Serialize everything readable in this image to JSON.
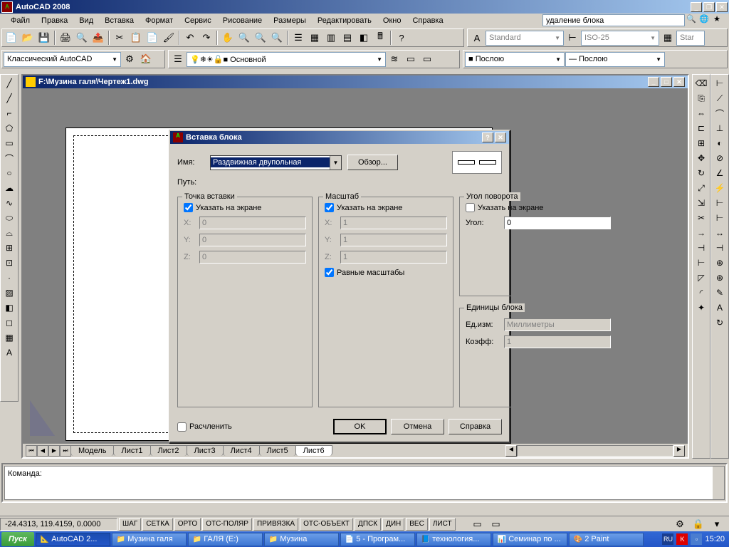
{
  "app": {
    "title": "AutoCAD 2008",
    "search_value": "удаление блока"
  },
  "menu": [
    "Файл",
    "Правка",
    "Вид",
    "Вставка",
    "Формат",
    "Сервис",
    "Рисование",
    "Размеры",
    "Редактировать",
    "Окно",
    "Справка"
  ],
  "toolbar3": {
    "workspace": "Классический AutoCAD",
    "layer": "Основной",
    "color": "Послою",
    "linetype": "Послою",
    "textstyle": "Standard",
    "dimstyle": "ISO-25",
    "tablestyle": "Star"
  },
  "doc": {
    "title": "F:\\Музина галя\\Чертеж1.dwg"
  },
  "tabs": [
    "Модель",
    "Лист1",
    "Лист2",
    "Лист3",
    "Лист4",
    "Лист5",
    "Лист6"
  ],
  "active_tab": "Лист6",
  "cmd": {
    "prompt": "Команда:"
  },
  "status": {
    "coords": "-24.4313, 119.4159, 0.0000",
    "buttons": [
      "ШАГ",
      "СЕТКА",
      "ОРТО",
      "ОТС-ПОЛЯР",
      "ПРИВЯЗКА",
      "ОТС-ОБЪЕКТ",
      "ДПСК",
      "ДИН",
      "ВЕС",
      "ЛИСТ"
    ]
  },
  "taskbar": {
    "start": "Пуск",
    "items": [
      "AutoCAD 2...",
      "Музина галя",
      "ГАЛЯ (E:)",
      "Музина",
      "5 - Програм...",
      "технология...",
      "Семинар по ...",
      "2 Paint"
    ],
    "active": 0,
    "lang": "RU",
    "time": "15:20"
  },
  "dialog": {
    "title": "Вставка блока",
    "name_label": "Имя:",
    "name_value": "Раздвижная двупольная",
    "browse": "Обзор...",
    "path_label": "Путь:",
    "group1": {
      "title": "Точка вставки",
      "specify": "Указать на экране",
      "x": "0",
      "y": "0",
      "z": "0"
    },
    "group2": {
      "title": "Масштаб",
      "specify": "Указать на экране",
      "x": "1",
      "y": "1",
      "z": "1",
      "uniform": "Равные масштабы"
    },
    "group3": {
      "title": "Угол поворота",
      "specify": "Указать на экране",
      "angle_label": "Угол:",
      "angle": "0"
    },
    "group4": {
      "title": "Единицы блока",
      "unit_label": "Ед.изм:",
      "unit": "Миллиметры",
      "factor_label": "Коэфф:",
      "factor": "1"
    },
    "explode": "Расчленить",
    "ok": "OK",
    "cancel": "Отмена",
    "help": "Справка"
  }
}
